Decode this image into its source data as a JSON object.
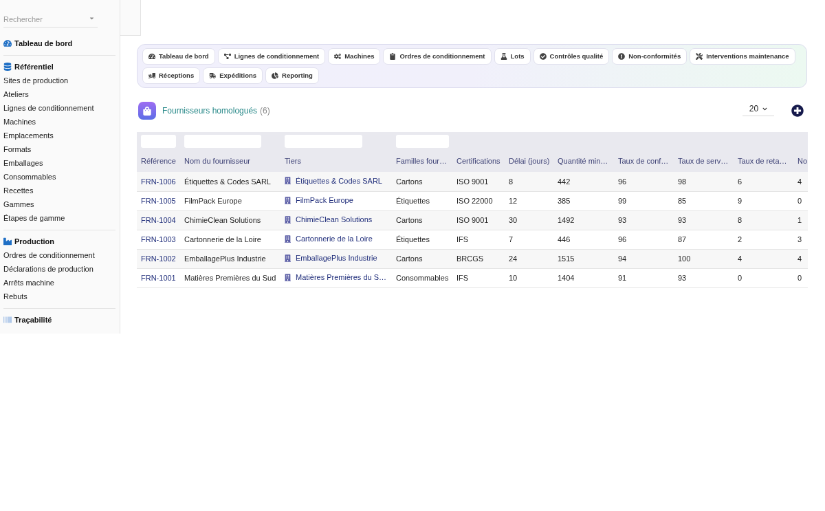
{
  "sidebar": {
    "search": {
      "placeholder": "Rechercher"
    },
    "sections": [
      {
        "title": "Tableau de bord"
      },
      {
        "title": "Référentiel",
        "items": [
          "Sites de production",
          "Ateliers",
          "Lignes de conditionnement",
          "Machines",
          "Emplacements",
          "Formats",
          "Emballages",
          "Consommables",
          "Recettes",
          "Gammes",
          "Étapes de gamme"
        ]
      },
      {
        "title": "Production",
        "items": [
          "Ordres de conditionnement",
          "Déclarations de production",
          "Arrêts machine",
          "Rebuts"
        ]
      },
      {
        "title": "Traçabilité"
      }
    ]
  },
  "shortcuts": [
    {
      "label": "Tableau de bord"
    },
    {
      "label": "Lignes de conditionnement"
    },
    {
      "label": "Machines"
    },
    {
      "label": "Ordres de conditionnement"
    },
    {
      "label": "Lots"
    },
    {
      "label": "Contrôles qualité"
    },
    {
      "label": "Non-conformités"
    },
    {
      "label": "Interventions maintenance"
    },
    {
      "label": "Réceptions"
    },
    {
      "label": "Expéditions"
    },
    {
      "label": "Reporting"
    }
  ],
  "list": {
    "title": "Fournisseurs homologués",
    "count": "(6)",
    "page_size": "20"
  },
  "table": {
    "columns": [
      {
        "label": "Référence",
        "kind": "link",
        "filter": true
      },
      {
        "label": "Nom du fournisseur",
        "kind": "text",
        "filter": true
      },
      {
        "label": "Tiers",
        "kind": "entity_link",
        "filter": true
      },
      {
        "label": "Familles four…",
        "kind": "text",
        "filter": true
      },
      {
        "label": "Certifications",
        "kind": "text",
        "filter": false
      },
      {
        "label": "Délai (jours)",
        "kind": "text",
        "filter": false
      },
      {
        "label": "Quantité min…",
        "kind": "text",
        "filter": false
      },
      {
        "label": "Taux de conf…",
        "kind": "text",
        "filter": false
      },
      {
        "label": "Taux de serv…",
        "kind": "text",
        "filter": false
      },
      {
        "label": "Taux de reta…",
        "kind": "text",
        "filter": false
      },
      {
        "label": "No",
        "kind": "text",
        "filter": false
      }
    ],
    "rows": [
      {
        "cells": [
          "FRN-1006",
          "Étiquettes & Codes SARL",
          "Étiquettes & Codes SARL",
          "Cartons",
          "ISO 9001",
          "8",
          "442",
          "96",
          "98",
          "6",
          "4"
        ]
      },
      {
        "cells": [
          "FRN-1005",
          "FilmPack Europe",
          "FilmPack Europe",
          "Étiquettes",
          "ISO 22000",
          "12",
          "385",
          "99",
          "85",
          "9",
          "0"
        ]
      },
      {
        "cells": [
          "FRN-1004",
          "ChimieClean Solutions",
          "ChimieClean Solutions",
          "Cartons",
          "ISO 9001",
          "30",
          "1492",
          "93",
          "93",
          "8",
          "1"
        ]
      },
      {
        "cells": [
          "FRN-1003",
          "Cartonnerie de la Loire",
          "Cartonnerie de la Loire",
          "Étiquettes",
          "IFS",
          "7",
          "446",
          "96",
          "87",
          "2",
          "3"
        ]
      },
      {
        "cells": [
          "FRN-1002",
          "EmballagePlus Industrie",
          "EmballagePlus Industrie",
          "Cartons",
          "BRCGS",
          "24",
          "1515",
          "94",
          "100",
          "4",
          "4"
        ]
      },
      {
        "cells": [
          "FRN-1001",
          "Matières Premières du Sud",
          "Matières Premières du S…",
          "Consommables",
          "IFS",
          "10",
          "1404",
          "91",
          "93",
          "0",
          "0"
        ]
      }
    ]
  }
}
